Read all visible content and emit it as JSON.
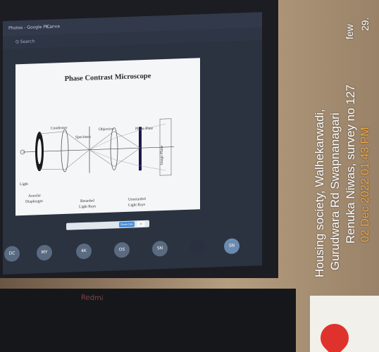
{
  "browser": {
    "tab1": "Photos - Google Ph...",
    "tab2": "Canva",
    "search": "Q Search"
  },
  "slide": {
    "title": "Phase Contrast Microscope",
    "labels": {
      "condenser": "Condenser",
      "objective": "Objective",
      "phase_plate": "Phase Plate",
      "specimen": "Specimen",
      "light": "Light",
      "annular1": "Annular",
      "annular2": "Diaphragm",
      "retarded1": "Retarded",
      "retarded2": "Light Rays",
      "unretarded1": "Unretarded",
      "unretarded2": "Light Rays",
      "image_plane": "Image Plane"
    },
    "caption_btn": "Share this"
  },
  "participants": [
    "DC",
    "MY",
    "4K",
    "OS",
    "SN",
    "",
    "SN"
  ],
  "laptop_brand": "Redmi",
  "overlay": {
    "line1": "Renuka Niwas, survey no 127",
    "line2": "Gurudwara Rd Swapnanagari",
    "line3": "Housing society, Walhekarwadi,",
    "date": "02 Dec 2022 01:43 PM",
    "few": "few",
    "num": "29."
  },
  "colors": {
    "slide_bg": "#f4f6f8",
    "overlay_date": "#f0a640",
    "pin": "#e0322c"
  }
}
